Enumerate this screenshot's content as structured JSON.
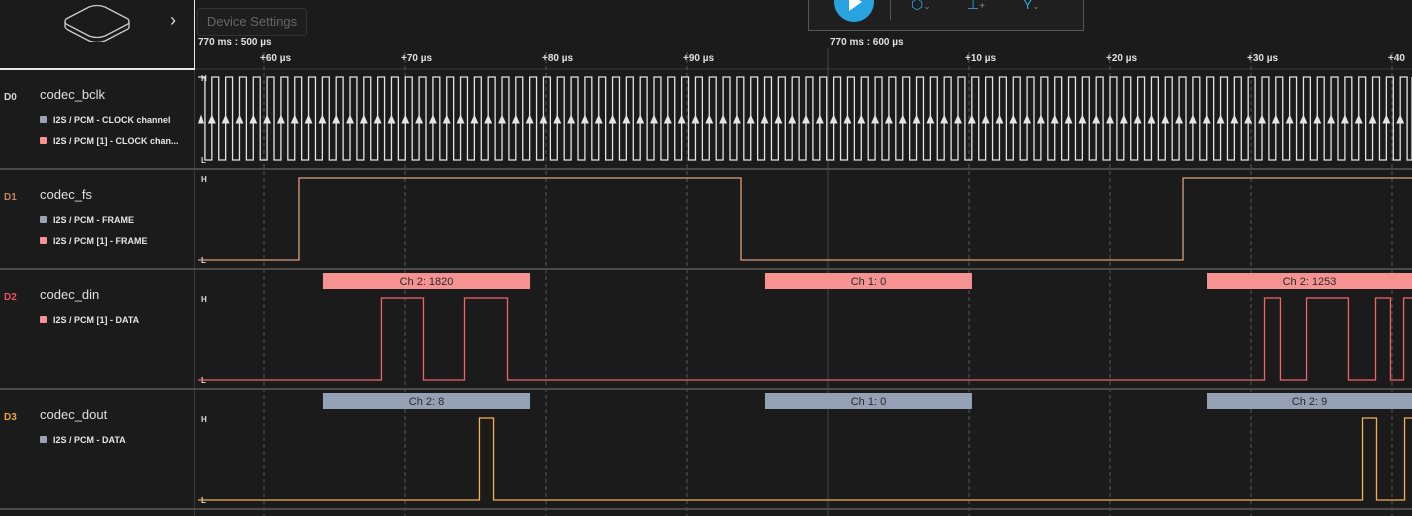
{
  "device": {
    "icon": "device-icon",
    "settings_label": "Device Settings"
  },
  "toolbar": {
    "play": "play-icon",
    "trigger": "trigger-icon",
    "measure": "measure-icon",
    "analyzer": "analyzer-icon"
  },
  "timeline": {
    "left_label": "770 ms : 500 µs",
    "major_label": "770 ms : 600 µs",
    "ticks": [
      {
        "t": 60,
        "label": "+60 µs"
      },
      {
        "t": 70,
        "label": "+70 µs"
      },
      {
        "t": 80,
        "label": "+80 µs"
      },
      {
        "t": 90,
        "label": "+90 µs"
      },
      {
        "t": 110,
        "label": "+10 µs"
      },
      {
        "t": 120,
        "label": "+20 µs"
      },
      {
        "t": 130,
        "label": "+30 µs"
      },
      {
        "t": 140,
        "label": "+40"
      }
    ],
    "major_t": 100,
    "unit": "µs offset from 770 ms : 500 µs"
  },
  "channels": [
    {
      "id": "D0",
      "name": "codec_bclk",
      "color": "#d8d8d8",
      "wave": "#e4e4e4",
      "analyzers": [
        {
          "label": "I2S / PCM - CLOCK channel",
          "color": "#9aa3b5"
        },
        {
          "label": "I2S / PCM [1] - CLOCK chan...",
          "color": "#f59393"
        }
      ],
      "clock": {
        "first_rise": 55.32,
        "period": 0.98
      },
      "rising_markers": true
    },
    {
      "id": "D1",
      "name": "codec_fs",
      "color": "#c9845c",
      "wave": "#d9a07a",
      "analyzers": [
        {
          "label": "I2S / PCM - FRAME",
          "color": "#9aa3b5"
        },
        {
          "label": "I2S / PCM [1] - FRAME",
          "color": "#f59393"
        }
      ],
      "initial": 0,
      "transitions": [
        62.48,
        93.83,
        125.18
      ]
    },
    {
      "id": "D2",
      "name": "codec_din",
      "color": "#e8535d",
      "wave": "#f0636c",
      "analyzers": [
        {
          "label": "I2S / PCM [1] - DATA",
          "color": "#f59393"
        }
      ],
      "initial": 0,
      "transitions": [
        68.33,
        71.31,
        74.22,
        77.27,
        130.96,
        132.09,
        133.94,
        136.91,
        138.83,
        139.89,
        140.82
      ],
      "frames": [
        {
          "start": 64.18,
          "end": 78.87,
          "label": "Ch 2: 1820"
        },
        {
          "start": 95.53,
          "end": 110.21,
          "label": "Ch 1: 0"
        },
        {
          "start": 126.88,
          "end": 142,
          "label": "Ch 2: 1253"
        }
      ],
      "frame_color": "#f59393"
    },
    {
      "id": "D3",
      "name": "codec_dout",
      "color": "#e8a54b",
      "wave": "#f5b04f",
      "analyzers": [
        {
          "label": "I2S / PCM - DATA",
          "color": "#9aa3b5"
        }
      ],
      "initial": 0,
      "transitions": [
        75.28,
        76.28,
        137.91,
        138.9,
        140.89
      ],
      "frames": [
        {
          "start": 64.18,
          "end": 78.87,
          "label": "Ch 2: 8"
        },
        {
          "start": 95.53,
          "end": 110.21,
          "label": "Ch 1: 0"
        },
        {
          "start": 126.88,
          "end": 142,
          "label": "Ch 2: 9"
        }
      ],
      "frame_color": "#94a0b4"
    }
  ],
  "level_labels": {
    "high": "H",
    "low": "L"
  }
}
